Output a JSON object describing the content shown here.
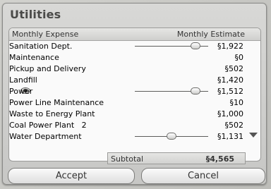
{
  "window": {
    "title": "Utilities"
  },
  "table": {
    "columns": {
      "expense": "Monthly Expense",
      "estimate": "Monthly Estimate"
    },
    "rows": [
      {
        "label": "Sanitation Dept.",
        "value": "§1,922",
        "kind": "dept",
        "slider": 0.83
      },
      {
        "label": "Maintenance",
        "value": "§0",
        "kind": "sub"
      },
      {
        "label": "Pickup and Delivery",
        "value": "§502",
        "kind": "sub"
      },
      {
        "label": "Landfill",
        "value": "§1,420",
        "kind": "sub"
      },
      {
        "label": "Power",
        "value": "§1,512",
        "kind": "dept",
        "slider": 0.83,
        "icon": "eye-icon"
      },
      {
        "label": "Power Line Maintenance",
        "value": "§10",
        "kind": "sub"
      },
      {
        "label": "Waste to Energy Plant",
        "value": "§1,000",
        "kind": "sub"
      },
      {
        "label": "Coal Power Plant   2",
        "value": "§502",
        "kind": "sub"
      },
      {
        "label": "Water Department",
        "value": "§1,131",
        "kind": "dept",
        "slider": 0.5
      }
    ],
    "scroll_icon": "triangle-down-icon"
  },
  "subtotal": {
    "label": "Subtotal",
    "value": "§4,565"
  },
  "buttons": {
    "accept": "Accept",
    "cancel": "Cancel"
  }
}
